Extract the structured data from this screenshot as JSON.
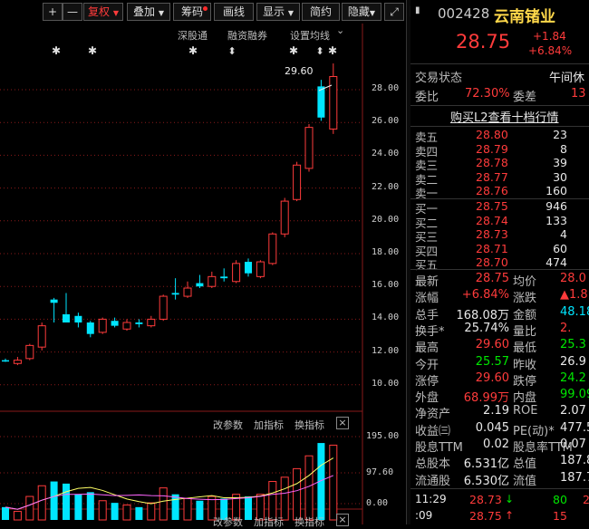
{
  "toolbar": {
    "plus": "+",
    "minus": "—",
    "fuquan": "复权",
    "diejia": "叠加",
    "chouma": "筹码",
    "huaxian": "画线",
    "xianshi": "显示",
    "jianyue": "简约",
    "yincang": "隐藏",
    "expand": "⤢"
  },
  "chart": {
    "top_labels": {
      "shengutong": "深股通",
      "rongzi": "融资融券",
      "shezhi": "设置均线"
    },
    "max_label": "29.60",
    "price_axis": [
      "28.00",
      "26.00",
      "24.00",
      "22.00",
      "20.00",
      "18.00",
      "16.00",
      "14.00",
      "12.00",
      "10.00"
    ],
    "volume_axis": [
      "195.00",
      "97.60",
      "0.00"
    ],
    "toolbar1": {
      "change_params": "改参数",
      "add_indicator": "加指标",
      "switch_indicator": "换指标",
      "close": "×"
    },
    "toolbar2": {
      "change_params": "改参数",
      "add_indicator": "加指标",
      "switch_indicator": "换指标",
      "close": "×"
    }
  },
  "chart_data": {
    "type": "candlestick",
    "price_ylim": [
      9.0,
      30.0
    ],
    "candles": [
      {
        "o": 11.5,
        "c": 11.5,
        "h": 11.6,
        "l": 11.4,
        "up": false,
        "vol": 30
      },
      {
        "o": 11.3,
        "c": 11.5,
        "h": 11.7,
        "l": 11.2,
        "up": true,
        "vol": 20
      },
      {
        "o": 11.6,
        "c": 12.4,
        "h": 12.5,
        "l": 11.5,
        "up": true,
        "vol": 55
      },
      {
        "o": 12.3,
        "c": 13.6,
        "h": 13.8,
        "l": 12.1,
        "up": true,
        "vol": 80
      },
      {
        "o": 15.0,
        "c": 15.2,
        "h": 15.3,
        "l": 13.8,
        "up": false,
        "vol": 90
      },
      {
        "o": 14.3,
        "c": 13.8,
        "h": 15.6,
        "l": 13.8,
        "up": false,
        "vol": 85
      },
      {
        "o": 14.2,
        "c": 13.8,
        "h": 14.4,
        "l": 13.5,
        "up": false,
        "vol": 60
      },
      {
        "o": 13.8,
        "c": 13.1,
        "h": 13.9,
        "l": 12.9,
        "up": false,
        "vol": 65
      },
      {
        "o": 13.2,
        "c": 14.0,
        "h": 14.1,
        "l": 13.1,
        "up": true,
        "vol": 45
      },
      {
        "o": 13.9,
        "c": 13.6,
        "h": 14.1,
        "l": 13.5,
        "up": false,
        "vol": 40
      },
      {
        "o": 13.4,
        "c": 13.8,
        "h": 14.0,
        "l": 13.3,
        "up": true,
        "vol": 35
      },
      {
        "o": 13.8,
        "c": 13.7,
        "h": 14.0,
        "l": 13.5,
        "up": false,
        "vol": 30
      },
      {
        "o": 13.6,
        "c": 14.0,
        "h": 14.2,
        "l": 13.5,
        "up": true,
        "vol": 40
      },
      {
        "o": 14.0,
        "c": 15.4,
        "h": 15.5,
        "l": 13.9,
        "up": true,
        "vol": 75
      },
      {
        "o": 15.6,
        "c": 15.5,
        "h": 16.5,
        "l": 15.2,
        "up": false,
        "vol": 60
      },
      {
        "o": 15.4,
        "c": 15.9,
        "h": 16.3,
        "l": 15.3,
        "up": true,
        "vol": 50
      },
      {
        "o": 16.2,
        "c": 16.0,
        "h": 16.7,
        "l": 15.9,
        "up": false,
        "vol": 45
      },
      {
        "o": 16.0,
        "c": 16.6,
        "h": 16.9,
        "l": 15.9,
        "up": true,
        "vol": 55
      },
      {
        "o": 16.6,
        "c": 16.5,
        "h": 17.1,
        "l": 16.3,
        "up": false,
        "vol": 50
      },
      {
        "o": 16.3,
        "c": 17.4,
        "h": 17.6,
        "l": 16.2,
        "up": true,
        "vol": 60
      },
      {
        "o": 17.5,
        "c": 16.8,
        "h": 17.7,
        "l": 16.6,
        "up": false,
        "vol": 55
      },
      {
        "o": 16.6,
        "c": 17.5,
        "h": 17.6,
        "l": 16.5,
        "up": true,
        "vol": 60
      },
      {
        "o": 17.4,
        "c": 19.2,
        "h": 19.3,
        "l": 17.3,
        "up": true,
        "vol": 90
      },
      {
        "o": 19.2,
        "c": 21.2,
        "h": 21.4,
        "l": 19.0,
        "up": true,
        "vol": 100
      },
      {
        "o": 21.3,
        "c": 23.4,
        "h": 23.6,
        "l": 21.2,
        "up": true,
        "vol": 120
      },
      {
        "o": 23.2,
        "c": 25.7,
        "h": 25.9,
        "l": 23.0,
        "up": true,
        "vol": 150
      },
      {
        "o": 26.3,
        "c": 28.2,
        "h": 28.6,
        "l": 26.1,
        "up": false,
        "vol": 180
      },
      {
        "o": 25.6,
        "c": 28.8,
        "h": 29.6,
        "l": 25.3,
        "up": true,
        "vol": 175
      }
    ]
  },
  "panel": {
    "code": "002428",
    "name": "云南锗业",
    "price": "28.75",
    "change": "+1.84",
    "change_pct": "+6.84%",
    "status_label": "交易状态",
    "status_value": "午间休",
    "weibi_label": "委比",
    "weibi_value": "72.30%",
    "weicha_label": "委差",
    "weicha_value": "13",
    "l2_link": "购买L2查看十档行情",
    "asks": [
      {
        "label": "卖五",
        "price": "28.80",
        "vol": "23"
      },
      {
        "label": "卖四",
        "price": "28.79",
        "vol": "8"
      },
      {
        "label": "卖三",
        "price": "28.78",
        "vol": "39"
      },
      {
        "label": "卖二",
        "price": "28.77",
        "vol": "30"
      },
      {
        "label": "卖一",
        "price": "28.76",
        "vol": "160"
      }
    ],
    "bids": [
      {
        "label": "买一",
        "price": "28.75",
        "vol": "946"
      },
      {
        "label": "买二",
        "price": "28.74",
        "vol": "133"
      },
      {
        "label": "买三",
        "price": "28.73",
        "vol": "4"
      },
      {
        "label": "买四",
        "price": "28.71",
        "vol": "60"
      },
      {
        "label": "买五",
        "price": "28.70",
        "vol": "474"
      }
    ],
    "stats": [
      {
        "l1": "最新",
        "v1": "28.75",
        "c1": "red",
        "l2": "均价",
        "v2": "28.0",
        "c2": "red"
      },
      {
        "l1": "涨幅",
        "v1": "+6.84%",
        "c1": "red",
        "l2": "涨跌",
        "v2": "▲1.8",
        "c2": "red"
      },
      {
        "l1": "总手",
        "v1": "168.08万",
        "c1": "white",
        "l2": "金额",
        "v2": "48.18",
        "c2": "cyan"
      },
      {
        "l1": "换手*",
        "v1": "25.74%",
        "c1": "white",
        "l2": "量比",
        "v2": "2.",
        "c2": "red"
      },
      {
        "l1": "最高",
        "v1": "29.60",
        "c1": "red",
        "l2": "最低",
        "v2": "25.3",
        "c2": "green"
      },
      {
        "l1": "今开",
        "v1": "25.57",
        "c1": "green",
        "l2": "昨收",
        "v2": "26.9",
        "c2": "white"
      },
      {
        "l1": "涨停",
        "v1": "29.60",
        "c1": "red",
        "l2": "跌停",
        "v2": "24.2",
        "c2": "green"
      },
      {
        "l1": "外盘",
        "v1": "68.99万",
        "c1": "red",
        "l2": "内盘",
        "v2": "99.09",
        "c2": "green"
      },
      {
        "l1": "净资产",
        "v1": "2.19",
        "c1": "white",
        "l2": "ROE",
        "v2": "2.07",
        "c2": "white"
      },
      {
        "l1": "收益㈢",
        "v1": "0.045",
        "c1": "white",
        "l2": "PE(动)*",
        "v2": "477.5",
        "c2": "white"
      },
      {
        "l1": "股息TTM",
        "v1": "0.02",
        "c1": "white",
        "l2": "股息率TTM",
        "v2": "0.07",
        "c2": "white"
      },
      {
        "l1": "总股本",
        "v1": "6.531亿",
        "c1": "white",
        "l2": "总值",
        "v2": "187.8",
        "c2": "white"
      },
      {
        "l1": "流通股",
        "v1": "6.530亿",
        "c1": "white",
        "l2": "流值",
        "v2": "187.7",
        "c2": "white"
      }
    ],
    "ticks": [
      {
        "time": "11:29",
        "price": "28.73",
        "arrow": "↓",
        "vol": "80",
        "extra": "2"
      },
      {
        "time": ":09",
        "price": "28.75",
        "arrow": "↑",
        "vol": "15",
        "extra": ""
      }
    ]
  }
}
